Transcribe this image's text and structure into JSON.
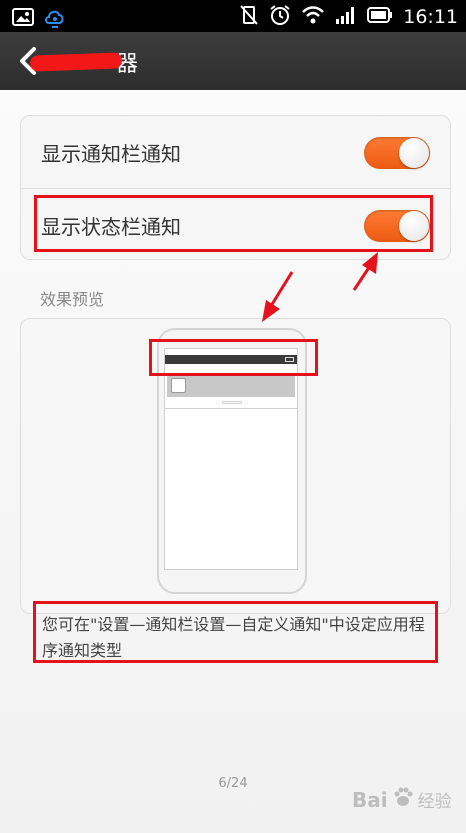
{
  "status_bar": {
    "time": "16:11",
    "left_icons": [
      "gallery-icon",
      "cloud-icon"
    ],
    "right_icons": [
      "vibrate-off-icon",
      "alarm-icon",
      "wifi-icon",
      "signal-icon",
      "battery-icon"
    ]
  },
  "title_bar": {
    "title_visible": "器",
    "back_icon": "chevron-left-icon"
  },
  "settings": {
    "items": [
      {
        "label": "显示通知栏通知",
        "toggle_on": true
      },
      {
        "label": "显示状态栏通知",
        "toggle_on": true
      }
    ],
    "accent": "#f26a24"
  },
  "preview": {
    "section_label": "效果预览"
  },
  "hint": {
    "text": "您可在\"设置—通知栏设置—自定义通知\"中设定应用程序通知类型"
  },
  "pager": {
    "text": "6/24"
  },
  "watermark": {
    "brand": "Bai",
    "suffix": "经验"
  },
  "annotation_color": "#e5121c"
}
